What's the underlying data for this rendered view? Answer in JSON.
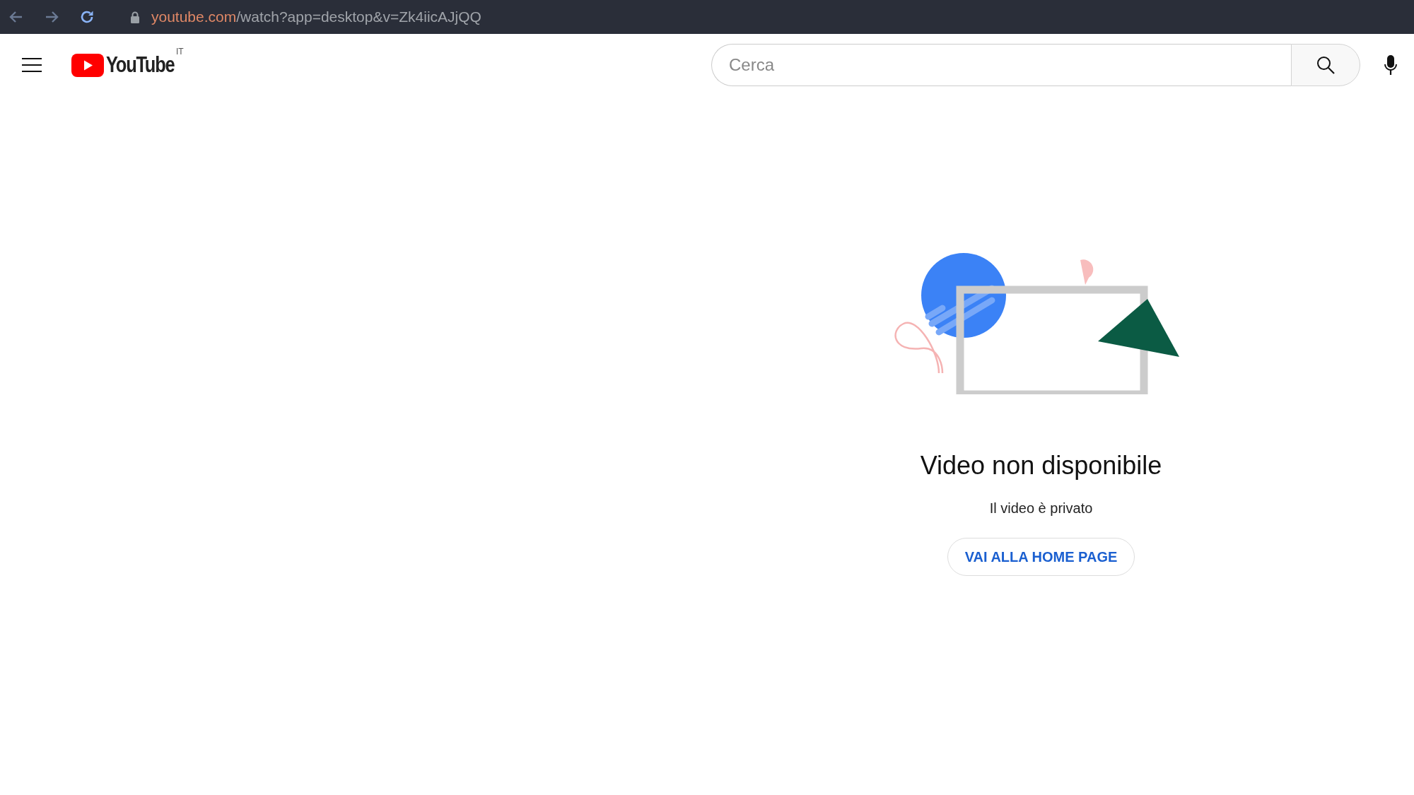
{
  "browser": {
    "url_host": "youtube.com",
    "url_path": "/watch?app=desktop&v=Zk4iicAJjQQ"
  },
  "header": {
    "logo_text": "YouTube",
    "region": "IT",
    "search": {
      "placeholder": "Cerca"
    }
  },
  "message": {
    "title": "Video non disponibile",
    "subtitle": "Il video è privato",
    "button": "VAI ALLA HOME PAGE"
  }
}
